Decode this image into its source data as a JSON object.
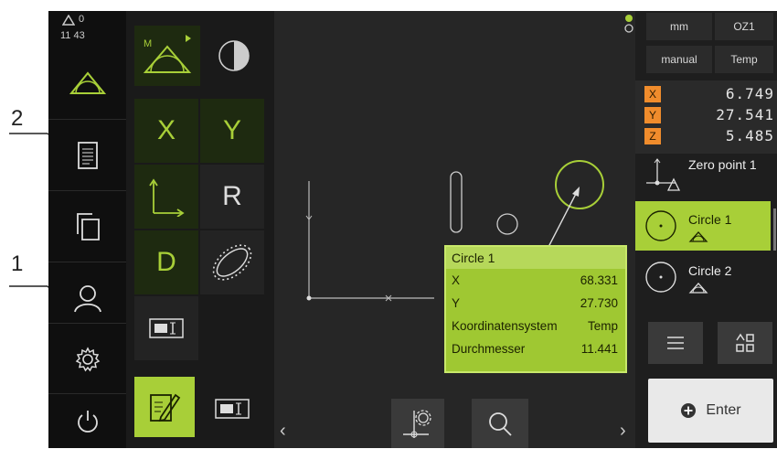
{
  "annotations": [
    "2",
    "1"
  ],
  "status": {
    "message_count": "0",
    "time": "11 43"
  },
  "tool_palette": {
    "sel_labels": [
      "X",
      "Y",
      "R",
      "D"
    ]
  },
  "workspace": {
    "callout": {
      "title": "Circle 1",
      "rows": [
        {
          "label": "X",
          "value": "68.331"
        },
        {
          "label": "Y",
          "value": "27.730"
        },
        {
          "label": "Koordinatensystem",
          "value": "Temp"
        },
        {
          "label": "Durchmesser",
          "value": "11.441"
        }
      ]
    }
  },
  "right_panel": {
    "unit": "mm",
    "ref": "OZ1",
    "mode": "manual",
    "coord_system": "Temp",
    "positions": [
      {
        "axis": "X",
        "value": "6.749"
      },
      {
        "axis": "Y",
        "value": "27.541"
      },
      {
        "axis": "Z",
        "value": "5.485"
      }
    ],
    "features": [
      "Zero point 1",
      "Circle 1",
      "Circle 2"
    ],
    "enter_label": "Enter"
  },
  "colors": {
    "accent": "#a8cf38",
    "axis": "#f08c2c",
    "background": "#262626"
  }
}
